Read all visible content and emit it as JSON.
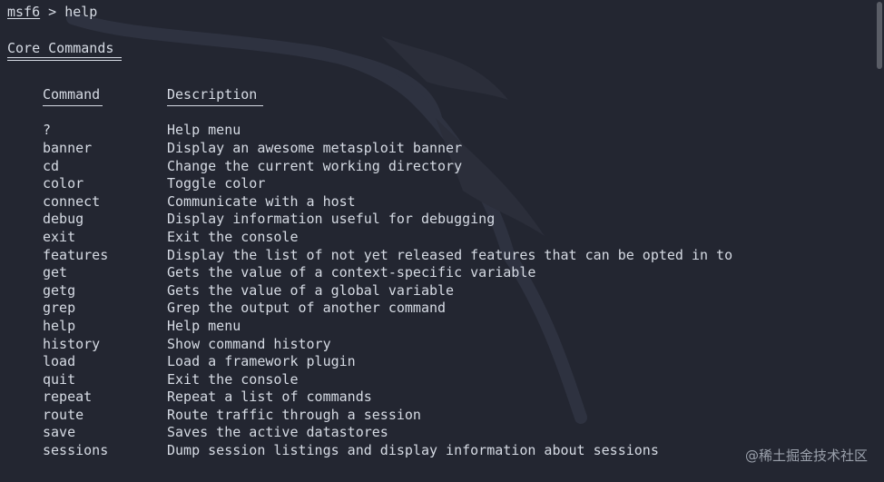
{
  "prompt": {
    "name": "msf6",
    "separator": " > ",
    "command": "help"
  },
  "section": {
    "title": "Core Commands"
  },
  "table": {
    "headers": {
      "command": "Command",
      "description": "Description"
    },
    "rows": [
      {
        "command": "?",
        "description": "Help menu"
      },
      {
        "command": "banner",
        "description": "Display an awesome metasploit banner"
      },
      {
        "command": "cd",
        "description": "Change the current working directory"
      },
      {
        "command": "color",
        "description": "Toggle color"
      },
      {
        "command": "connect",
        "description": "Communicate with a host"
      },
      {
        "command": "debug",
        "description": "Display information useful for debugging"
      },
      {
        "command": "exit",
        "description": "Exit the console"
      },
      {
        "command": "features",
        "description": "Display the list of not yet released features that can be opted in to"
      },
      {
        "command": "get",
        "description": "Gets the value of a context-specific variable"
      },
      {
        "command": "getg",
        "description": "Gets the value of a global variable"
      },
      {
        "command": "grep",
        "description": "Grep the output of another command"
      },
      {
        "command": "help",
        "description": "Help menu"
      },
      {
        "command": "history",
        "description": "Show command history"
      },
      {
        "command": "load",
        "description": "Load a framework plugin"
      },
      {
        "command": "quit",
        "description": "Exit the console"
      },
      {
        "command": "repeat",
        "description": "Repeat a list of commands"
      },
      {
        "command": "route",
        "description": "Route traffic through a session"
      },
      {
        "command": "save",
        "description": "Saves the active datastores"
      },
      {
        "command": "sessions",
        "description": "Dump session listings and display information about sessions"
      }
    ]
  },
  "watermark": "@稀土掘金技术社区",
  "colors": {
    "background": "#232631",
    "text": "#d6dbe4",
    "logo": "#2c2f3b"
  },
  "icons": {
    "background_logo": "kali-dragon-icon"
  }
}
